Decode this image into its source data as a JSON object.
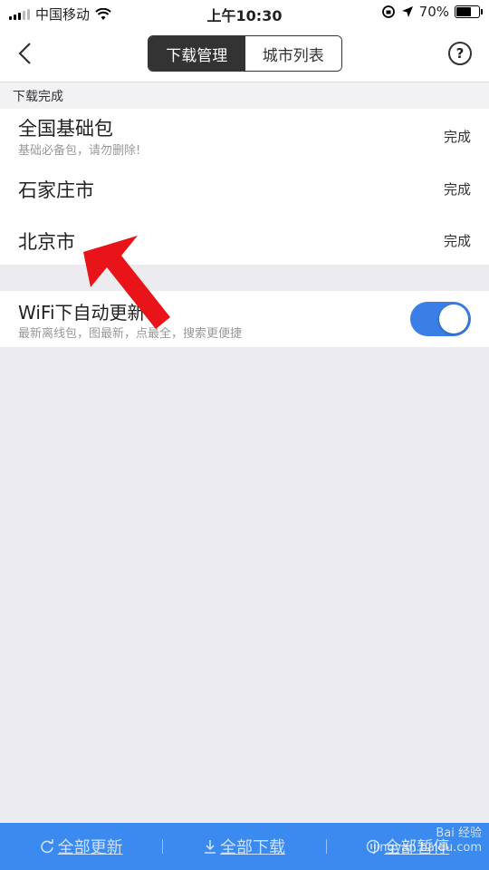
{
  "status_bar": {
    "carrier": "中国移动",
    "time": "上午10:30",
    "battery": "70%",
    "battery_level": 0.7
  },
  "nav": {
    "tabs": [
      {
        "label": "下载管理",
        "active": true
      },
      {
        "label": "城市列表",
        "active": false
      }
    ],
    "help_symbol": "?"
  },
  "section": {
    "title": "下载完成"
  },
  "downloads": [
    {
      "name": "全国基础包",
      "subtitle": "基础必备包，请勿删除!",
      "status": "完成"
    },
    {
      "name": "石家庄市",
      "subtitle": "",
      "status": "完成"
    },
    {
      "name": "北京市",
      "subtitle": "",
      "status": "完成"
    }
  ],
  "wifi_update": {
    "title": "WiFi下自动更新",
    "subtitle": "最新离线包，图最新，点最全，搜索更便捷",
    "enabled": true
  },
  "bottom_bar": {
    "update_all": "全部更新",
    "download_all": "全部下载",
    "pause_all": "全部暂停"
  },
  "watermark": {
    "line1": "Bai 经验",
    "line2": "jingyan.baidu.com"
  },
  "colors": {
    "accent": "#3a8af0",
    "toggle_on": "#3a7ee6",
    "annotation_arrow": "#e8141a"
  }
}
